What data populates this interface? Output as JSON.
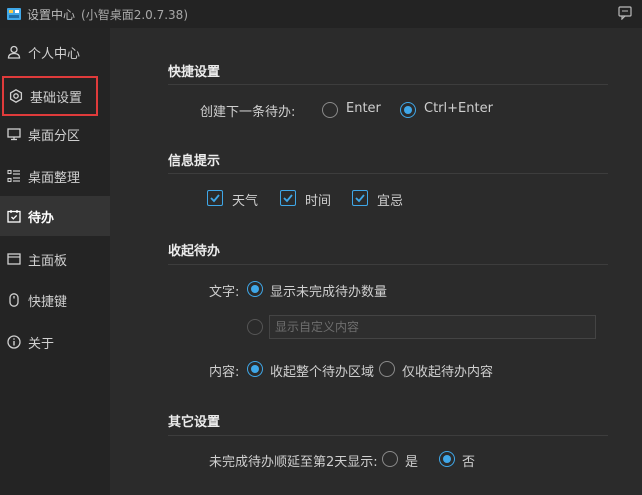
{
  "window": {
    "title": "设置中心",
    "version": "(小智桌面2.0.7.38)"
  },
  "sidebar": {
    "items": [
      {
        "label": "个人中心",
        "icon": "user-icon"
      },
      {
        "label": "基础设置",
        "icon": "settings-icon"
      },
      {
        "label": "桌面分区",
        "icon": "monitor-icon"
      },
      {
        "label": "桌面整理",
        "icon": "list-icon"
      },
      {
        "label": "待办",
        "icon": "calendar-icon",
        "active": true
      },
      {
        "label": "主面板",
        "icon": "panel-icon"
      },
      {
        "label": "快捷键",
        "icon": "mouse-icon"
      },
      {
        "label": "关于",
        "icon": "info-icon"
      }
    ]
  },
  "quick": {
    "title": "快捷设置",
    "create_label": "创建下一条待办:",
    "opt_enter": "Enter",
    "opt_ctrl_enter": "Ctrl+Enter",
    "selected": "Ctrl+Enter"
  },
  "notify": {
    "title": "信息提示",
    "weather": "天气",
    "time": "时间",
    "proverb": "宜忌"
  },
  "collapse": {
    "title": "收起待办",
    "text_label": "文字:",
    "show_count": "显示未完成待办数量",
    "custom_placeholder": "显示自定义内容",
    "content_label": "内容:",
    "collapse_all": "收起整个待办区域",
    "collapse_content": "仅收起待办内容"
  },
  "other": {
    "title": "其它设置",
    "postpone_label": "未完成待办顺延至第2天显示:",
    "yes": "是",
    "no": "否",
    "selected": "否"
  },
  "colors": {
    "accent": "#3fa7e8",
    "highlight_box": "#e03b3b",
    "sidebar_bg": "#242424",
    "content_bg": "#2b2b2b"
  }
}
